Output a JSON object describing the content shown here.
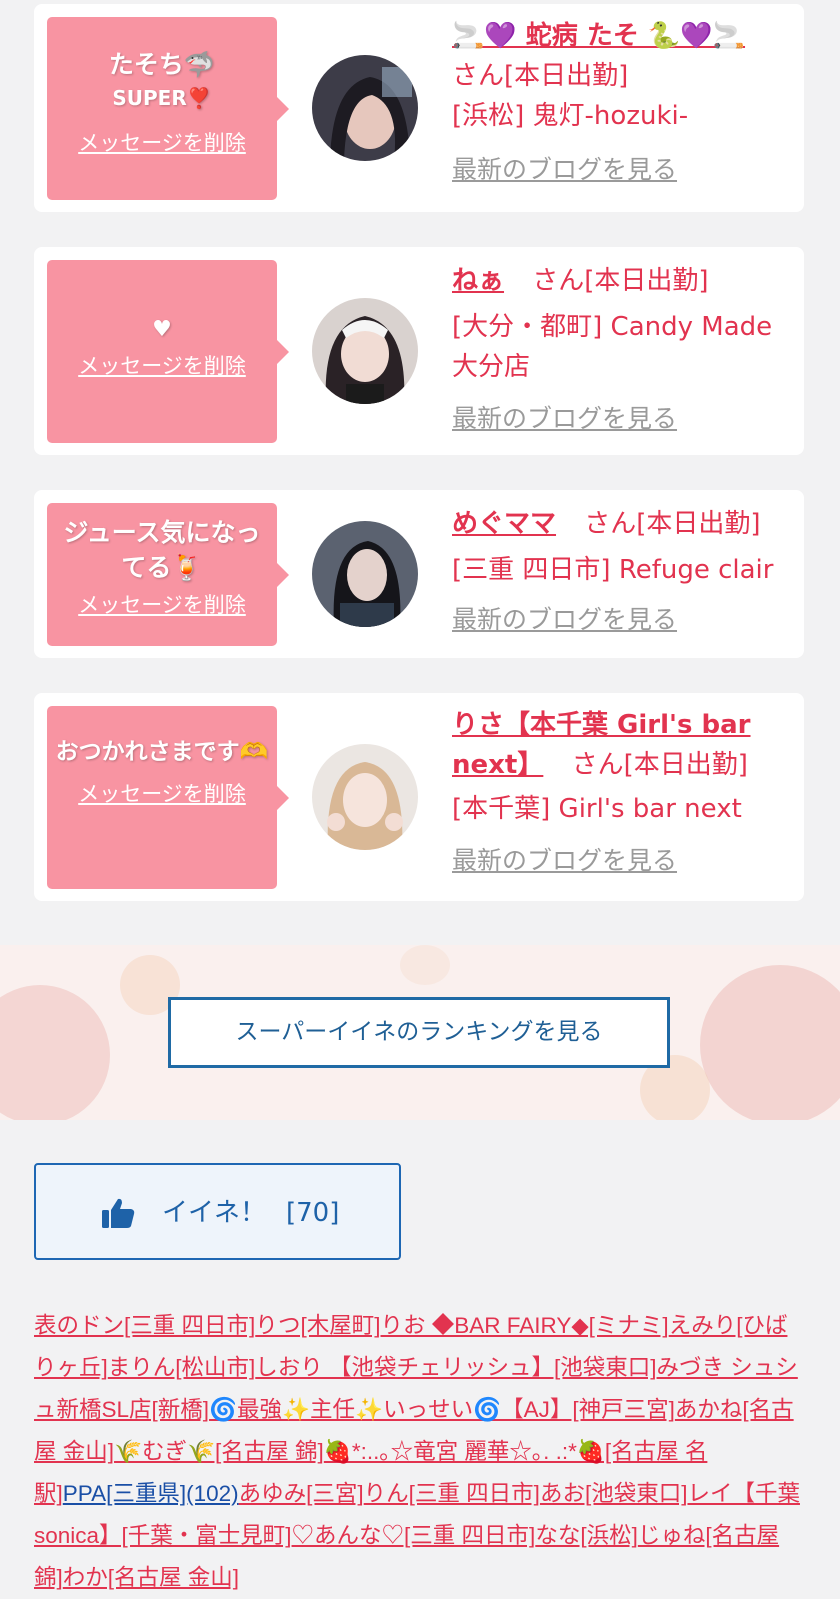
{
  "cards": [
    {
      "message_line1": "たそち🦈",
      "message_line2": "SUPER❣️",
      "delete_label": "メッセージを削除",
      "name": "🚬💜 蛇病 たそ 🐍💜🚬",
      "suffix": "さん[本日出勤]",
      "shop": "[浜松] 鬼灯-hozuki-",
      "blog_label": "最新のブログを見る"
    },
    {
      "message_line1": "♥",
      "delete_label": "メッセージを削除",
      "name": "ねぁ",
      "suffix": "さん[本日出勤]",
      "shop": "[大分・都町] Candy Made 大分店",
      "blog_label": "最新のブログを見る"
    },
    {
      "message_line1": "ジュース気になってる🍹",
      "delete_label": "メッセージを削除",
      "name": "めぐママ",
      "suffix": "さん[本日出勤]",
      "shop": "[三重 四日市] Refuge clair",
      "blog_label": "最新のブログを見る"
    },
    {
      "message_line1": "おつかれさまです🫶",
      "delete_label": "メッセージを削除",
      "name": "りさ【本千葉 Girl's bar next】",
      "suffix": "さん[本日出勤]",
      "shop": "[本千葉] Girl's bar next",
      "blog_label": "最新のブログを見る"
    }
  ],
  "ranking_button": "スーパーイイネのランキングを見る",
  "like_button": {
    "icon": "thumbs-up-icon",
    "label": "イイネ！",
    "count": "[70]"
  },
  "links": [
    "表のドン[三重 四日市]",
    "りつ[木屋町]",
    "りお ◆BAR FAIRY◆[ミナミ]",
    "えみり[ひばりヶ丘]",
    "まりん[松山市]",
    "しおり 【池袋チェリッシュ】[池袋東口]",
    "みづき シュシュ新橋SL店[新橋]",
    "🌀最強✨主任✨いっせい🌀【AJ】[神戸三宮]",
    "あかね[名古屋 金山]",
    "🌾むぎ🌾[名古屋 錦]",
    "🍓*:..｡☆竜宮 麗華☆｡. .:*🍓[名古屋 名駅]",
    "PPA[三重県](102)",
    "あゆみ[三宮]",
    "りん[三重 四日市]",
    "あお[池袋東口]",
    "レイ【千葉sonica】[千葉・富士見町]",
    "♡あんな♡[三重 四日市]",
    "なな[浜松]",
    "じゅね[名古屋 錦]",
    "わか[名古屋 金山]"
  ],
  "colors": {
    "accent_pink": "#e2334f",
    "bubble_pink": "#f894a2",
    "link_blue": "#1a4fa6"
  }
}
